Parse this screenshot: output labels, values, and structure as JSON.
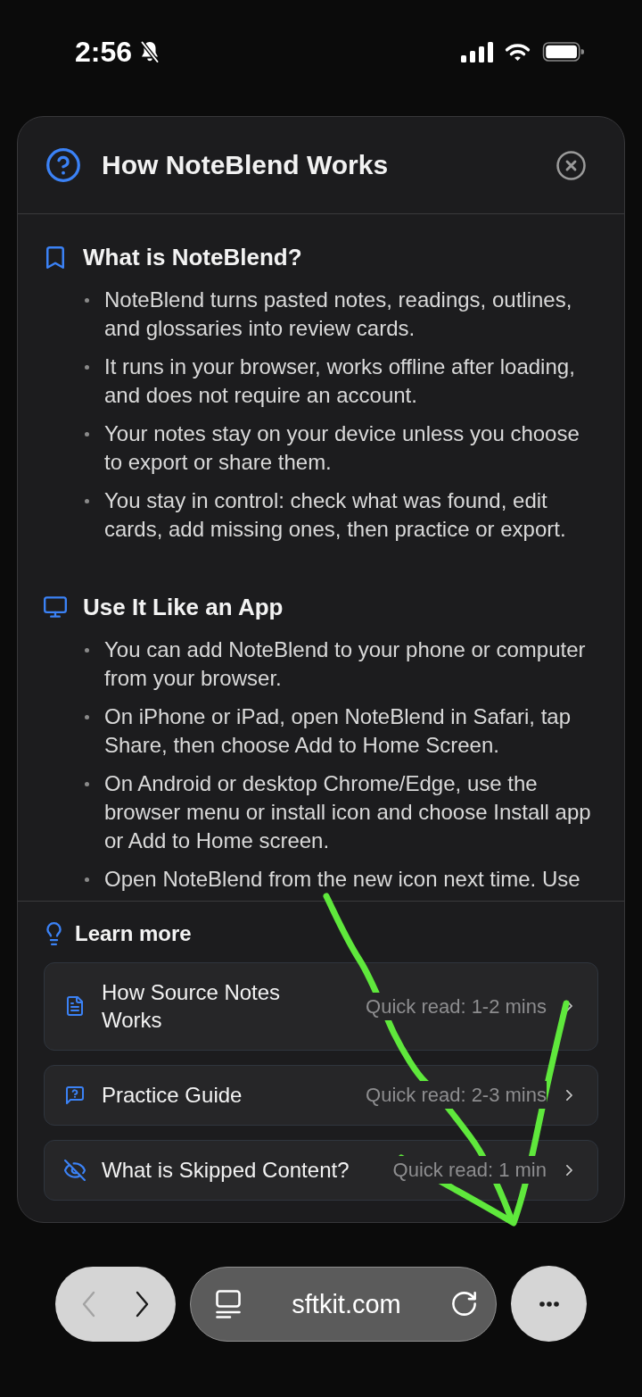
{
  "status_bar": {
    "time": "2:56",
    "silent": true
  },
  "dialog": {
    "title": "How NoteBlend Works",
    "sections": [
      {
        "kind": "bookmark",
        "heading": "What is NoteBlend?",
        "bullets": [
          "NoteBlend turns pasted notes, readings, outlines, and glossaries into review cards.",
          "It runs in your browser, works offline after loading, and does not require an account.",
          "Your notes stay on your device unless you choose to export or share them.",
          "You stay in control: check what was found, edit cards, add missing ones, then practice or export."
        ]
      },
      {
        "kind": "monitor",
        "heading": "Use It Like an App",
        "bullets": [
          "You can add NoteBlend to your phone or computer from your browser.",
          "On iPhone or iPad, open NoteBlend in Safari, tap Share, then choose Add to Home Screen.",
          "On Android or desktop Chrome/Edge, use the browser menu or install icon and choose Install app or Add to Home screen.",
          "Open NoteBlend from the new icon next time. Use"
        ]
      }
    ],
    "learn_more": {
      "heading": "Learn more",
      "links": [
        {
          "kind": "document",
          "title": "How Source Notes Works",
          "meta": "Quick read: 1-2 mins"
        },
        {
          "kind": "question",
          "title": "Practice Guide",
          "meta": "Quick read: 2-3 mins"
        },
        {
          "kind": "hidden",
          "title": "What is Skipped Content?",
          "meta": "Quick read: 1 min"
        }
      ]
    }
  },
  "browser_bar": {
    "back_disabled": true,
    "forward_disabled": false,
    "url": "sftkit.com"
  }
}
